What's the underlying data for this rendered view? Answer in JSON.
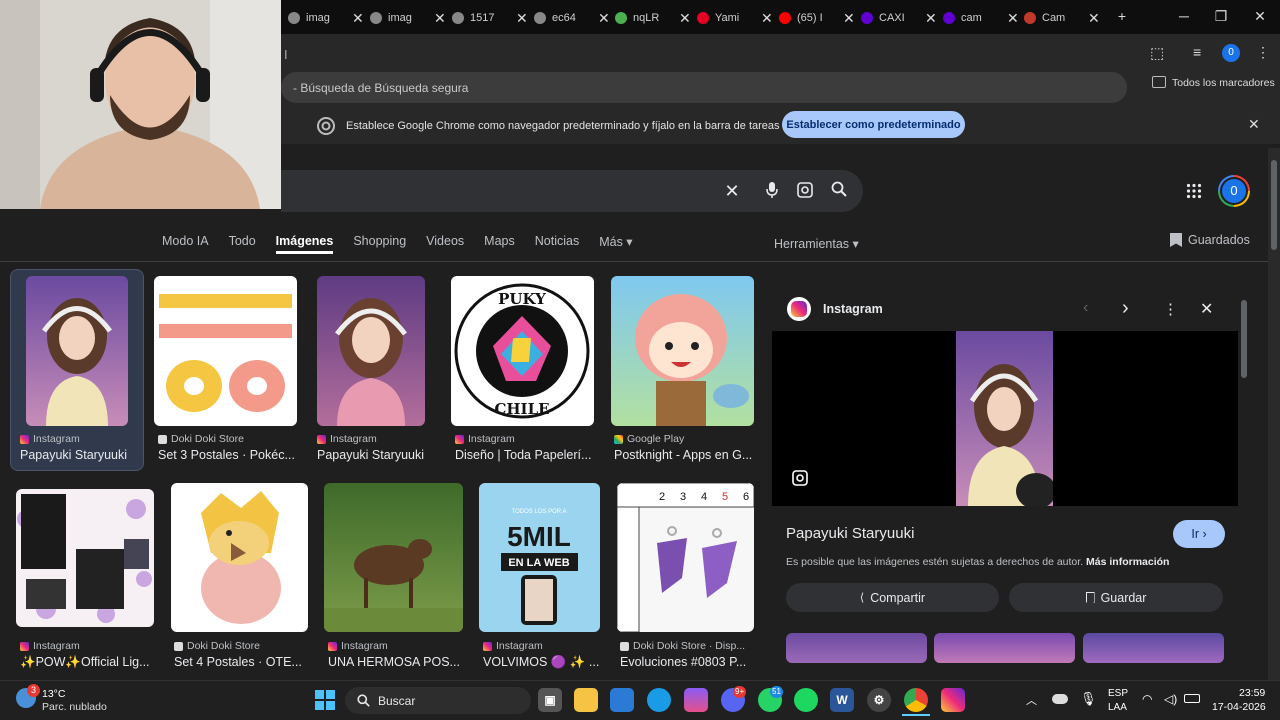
{
  "tabs": [
    {
      "label": "imag",
      "icon": "globe-icon"
    },
    {
      "label": "imag",
      "icon": "globe-icon"
    },
    {
      "label": "1517",
      "icon": "globe-icon"
    },
    {
      "label": "ec64",
      "icon": "globe-icon"
    },
    {
      "label": "nqLR",
      "icon": "pinwheel-icon"
    },
    {
      "label": "Yami",
      "icon": "pinterest-icon"
    },
    {
      "label": "(65) I",
      "icon": "youtube-icon"
    },
    {
      "label": "CAXI",
      "icon": "yahoo-icon"
    },
    {
      "label": "cam",
      "icon": "yahoo-icon"
    },
    {
      "label": "Cam",
      "icon": "circle-icon"
    }
  ],
  "new_tab": "+",
  "omnibox_text": "- Búsqueda de Búsqueda segura",
  "bookmarks_label": "Todos los marcadores",
  "profile_initial": "0",
  "infobar": {
    "message": "Establece Google Chrome como navegador predeterminado y fíjalo en la barra de tareas",
    "button": "Establecer como predeterminado"
  },
  "nav_tabs": [
    "Modo IA",
    "Todo",
    "Imágenes",
    "Shopping",
    "Videos",
    "Maps",
    "Noticias",
    "Más ▾"
  ],
  "tools_label": "Herramientas ▾",
  "saved_label": "Guardados",
  "results_row1": [
    {
      "source": "Instagram",
      "title": "Papayuki Staryuuki"
    },
    {
      "source": "Doki Doki Store",
      "title": "Set 3 Postales · Pokéc..."
    },
    {
      "source": "Instagram",
      "title": "Papayuki Staryuuki"
    },
    {
      "source": "Instagram",
      "title": "Diseño | Toda Papelerí..."
    },
    {
      "source": "Google Play",
      "title": "Postknight - Apps en G..."
    }
  ],
  "results_row2": [
    {
      "source": "Instagram",
      "title": "✨POW✨Official Lig..."
    },
    {
      "source": "Doki Doki Store",
      "title": "Set 4 Postales · OTE..."
    },
    {
      "source": "Instagram",
      "title": "UNA HERMOSA POS..."
    },
    {
      "source": "Instagram",
      "title": "VOLVIMOS 🟣 ✨ ..."
    },
    {
      "source": "Doki Doki Store · Disp...",
      "title": "Evoluciones #0803 P..."
    }
  ],
  "puky_text": "PUKY CHILE",
  "ad_text": {
    "small": "TODOS LOS POR A",
    "big": "5MIL",
    "banner": "EN LA WEB"
  },
  "ruler_numbers": [
    "2",
    "3",
    "4",
    "5",
    "6"
  ],
  "panel": {
    "source": "Instagram",
    "title": "Papayuki Staryuuki",
    "go_button": "Ir ›",
    "copyright": "Es posible que las imágenes estén sujetas a derechos de autor.",
    "more_info": "Más información",
    "share": "Compartir",
    "save": "Guardar"
  },
  "taskbar": {
    "temp": "13°C",
    "weather": "Parc. nublado",
    "search": "Buscar",
    "lang1": "ESP",
    "lang2": "LAA",
    "time": "23:59",
    "date": "17-04-2026",
    "weather_badge": "3",
    "discord_badge": "9+",
    "whatsapp_badge": "51"
  }
}
